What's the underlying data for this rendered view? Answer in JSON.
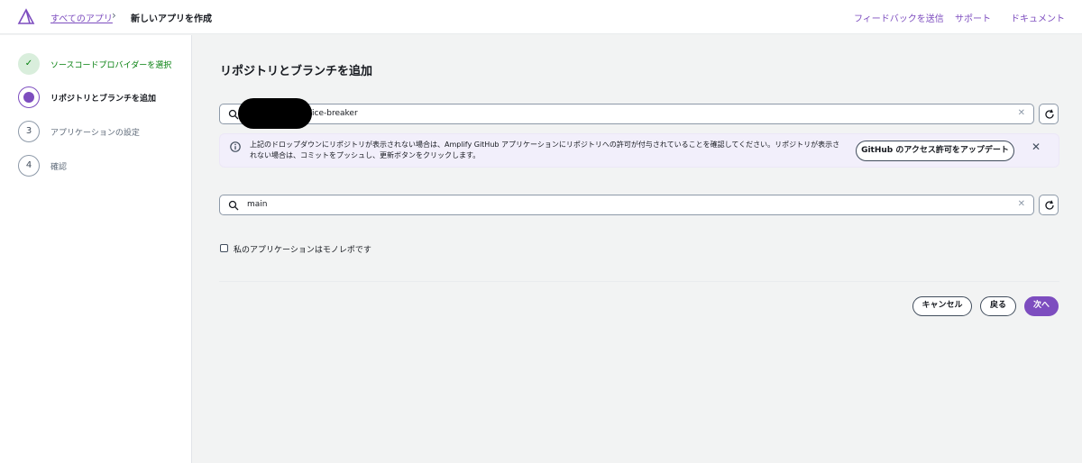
{
  "header": {
    "breadcrumb_link": "すべてのアプリ",
    "breadcrumb_sep": "›",
    "breadcrumb_current": "新しいアプリを作成",
    "links": {
      "feedback": "フィードバックを送信",
      "support": "サポート",
      "docs": "ドキュメント"
    }
  },
  "colors": {
    "accent": "#7d4dbf",
    "success": "#037f0c",
    "info_bg": "#f2effb"
  },
  "steps": [
    {
      "number": "✓",
      "label": "ソースコードプロバイダーを選択",
      "state": "done"
    },
    {
      "number": "",
      "label": "リポジトリとブランチを追加",
      "state": "active"
    },
    {
      "number": "3",
      "label": "アプリケーションの設定",
      "state": "pending"
    },
    {
      "number": "4",
      "label": "確認",
      "state": "pending"
    }
  ],
  "main": {
    "title": "リポジトリとブランチを追加",
    "repo_search": {
      "value": "/ice-breaker",
      "clear_icon": "✕",
      "icon": "search-icon"
    },
    "alert": {
      "text": "上記のドロップダウンにリポジトリが表示されない場合は、Amplify GitHub アプリケーションにリポジトリへの許可が付与されていることを確認してください。リポジトリが表示されない場合は、コミットをプッシュし、更新ボタンをクリックします。",
      "button": "GitHub のアクセス許可をアップデート",
      "close_icon": "✕"
    },
    "branch_search": {
      "value": "main",
      "clear_icon": "✕"
    },
    "monorepo_label": "私のアプリケーションはモノレポです",
    "buttons": {
      "cancel": "キャンセル",
      "back": "戻る",
      "next": "次へ"
    }
  }
}
